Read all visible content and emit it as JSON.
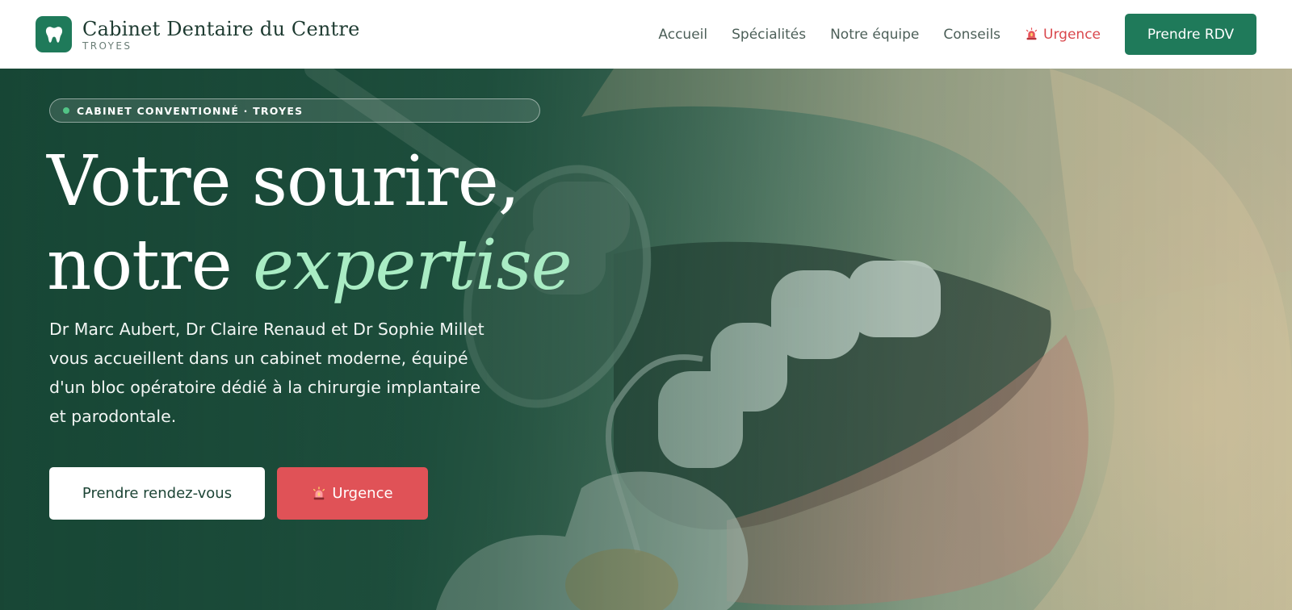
{
  "header": {
    "brand_name": "Cabinet Dentaire du Centre",
    "brand_city": "TROYES",
    "logo_icon": "tooth-icon",
    "nav": [
      {
        "label": "Accueil"
      },
      {
        "label": "Spécialités"
      },
      {
        "label": "Notre équipe"
      },
      {
        "label": "Conseils"
      }
    ],
    "urgent_label": "Urgence",
    "urgent_icon": "siren-icon",
    "cta_label": "Prendre RDV"
  },
  "hero": {
    "badge": "CABINET CONVENTIONNÉ · TROYES",
    "title_line1": "Votre sourire,",
    "title_line2": "notre ",
    "title_accent": "expertise",
    "lead": "Dr Marc Aubert, Dr Claire Renaud et Dr Sophie Millet vous accueillent dans un cabinet moderne, équipé d'un bloc opératoire dédié à la chirurgie implantaire et parodontale.",
    "primary_button": "Prendre rendez-vous",
    "urgent_button": "Urgence",
    "background_image": "dental-examination-photo"
  },
  "colors": {
    "brand_green": "#1f7a5a",
    "accent_mint": "#a9ecc4",
    "urgent_red": "#e05257",
    "nav_text": "#4c5f58"
  }
}
